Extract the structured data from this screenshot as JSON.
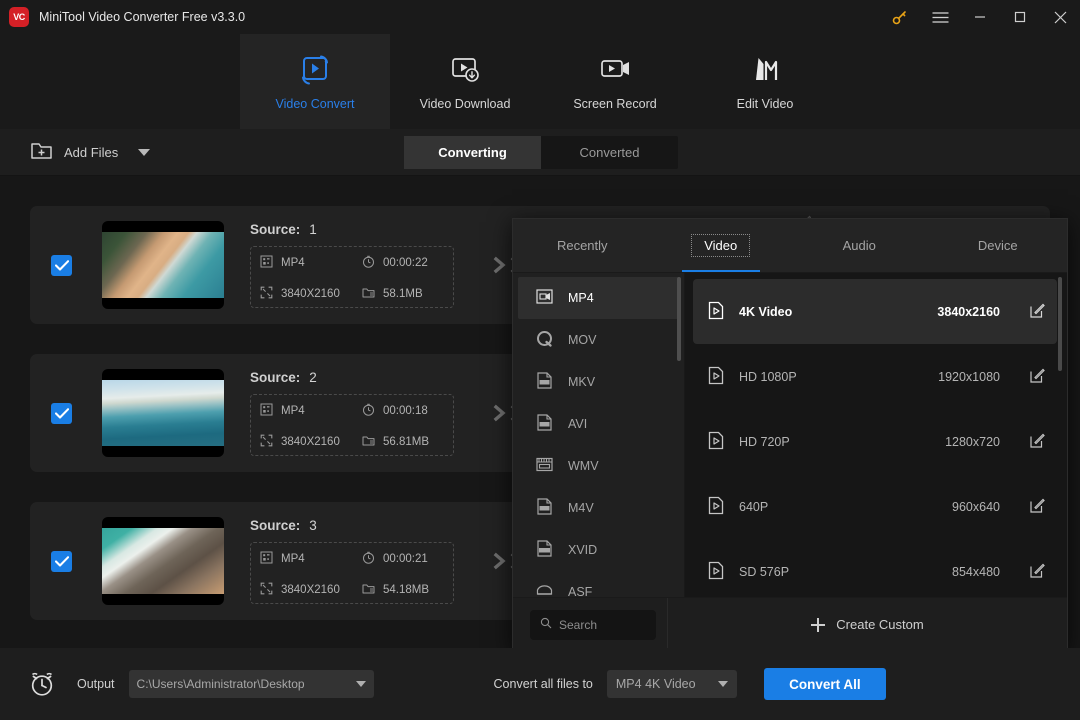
{
  "window": {
    "title": "MiniTool Video Converter Free v3.3.0",
    "logo_text": "VC",
    "controls": {
      "key": "key-icon",
      "menu": "hamburger-menu-icon",
      "minimize": "minimize-icon",
      "maximize": "maximize-icon",
      "close": "close-icon"
    }
  },
  "nav": {
    "tabs": [
      {
        "label": "Video Convert",
        "icon": "video-convert-icon",
        "active": true
      },
      {
        "label": "Video Download",
        "icon": "video-download-icon",
        "active": false
      },
      {
        "label": "Screen Record",
        "icon": "screen-record-icon",
        "active": false
      },
      {
        "label": "Edit Video",
        "icon": "edit-video-icon",
        "active": false
      }
    ]
  },
  "toolbar": {
    "add_files_label": "Add Files",
    "add_files_icon": "folder-plus-icon",
    "dropdown_icon": "chevron-down-icon",
    "segments": [
      {
        "label": "Converting",
        "active": true
      },
      {
        "label": "Converted",
        "active": false
      }
    ]
  },
  "file_list": {
    "source_label": "Source:",
    "rows": [
      {
        "checked": true,
        "index": "1",
        "format": "MP4",
        "duration": "00:00:22",
        "resolution": "3840X2160",
        "size": "58.1MB",
        "thumb_class": "t1"
      },
      {
        "checked": true,
        "index": "2",
        "format": "MP4",
        "duration": "00:00:18",
        "resolution": "3840X2160",
        "size": "56.81MB",
        "thumb_class": "t2"
      },
      {
        "checked": true,
        "index": "3",
        "format": "MP4",
        "duration": "00:00:21",
        "resolution": "3840X2160",
        "size": "54.18MB",
        "thumb_class": "t3"
      }
    ]
  },
  "format_panel": {
    "tabs": [
      {
        "label": "Recently",
        "active": false
      },
      {
        "label": "Video",
        "active": true
      },
      {
        "label": "Audio",
        "active": false
      },
      {
        "label": "Device",
        "active": false
      }
    ],
    "formats": [
      {
        "label": "MP4",
        "active": true
      },
      {
        "label": "MOV",
        "active": false
      },
      {
        "label": "MKV",
        "active": false
      },
      {
        "label": "AVI",
        "active": false
      },
      {
        "label": "WMV",
        "active": false
      },
      {
        "label": "M4V",
        "active": false
      },
      {
        "label": "XVID",
        "active": false
      },
      {
        "label": "ASF",
        "active": false
      }
    ],
    "resolutions": [
      {
        "name": "4K Video",
        "dimension": "3840x2160",
        "active": true
      },
      {
        "name": "HD 1080P",
        "dimension": "1920x1080",
        "active": false
      },
      {
        "name": "HD 720P",
        "dimension": "1280x720",
        "active": false
      },
      {
        "name": "640P",
        "dimension": "960x640",
        "active": false
      },
      {
        "name": "SD 576P",
        "dimension": "854x480",
        "active": false
      }
    ],
    "search_placeholder": "Search",
    "search_value": "",
    "search_icon": "search-icon",
    "create_custom_label": "Create Custom"
  },
  "bottom_bar": {
    "clock_icon": "alarm-clock-icon",
    "output_label": "Output",
    "output_path": "C:\\Users\\Administrator\\Desktop",
    "convert_to_label": "Convert all files to",
    "convert_to_value": "MP4 4K Video",
    "convert_all_label": "Convert All"
  },
  "colors": {
    "accent_blue": "#1a7ee5",
    "brand_red": "#d42026",
    "key_yellow": "#e8a317",
    "window_bg": "#1e1e1e",
    "panel_bg": "#212121",
    "list_bg": "#171717",
    "card_bg": "#222222"
  }
}
